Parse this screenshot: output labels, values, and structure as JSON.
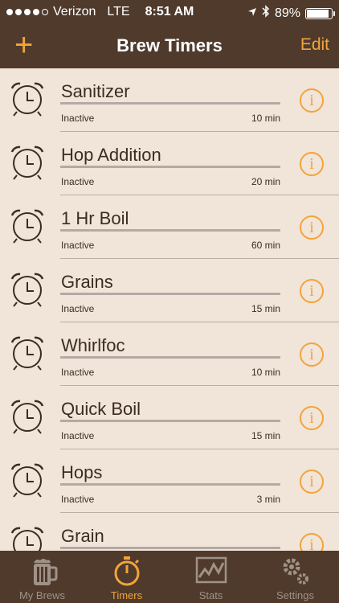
{
  "status_bar": {
    "carrier": "Verizon",
    "network": "LTE",
    "time": "8:51 AM",
    "battery": "89%",
    "battery_level": 0.89
  },
  "nav": {
    "add_label": "+",
    "title": "Brew Timers",
    "edit_label": "Edit"
  },
  "timers": [
    {
      "name": "Sanitizer",
      "status": "Inactive",
      "duration": "10 min"
    },
    {
      "name": "Hop Addition",
      "status": "Inactive",
      "duration": "20 min"
    },
    {
      "name": "1 Hr Boil",
      "status": "Inactive",
      "duration": "60 min"
    },
    {
      "name": "Grains",
      "status": "Inactive",
      "duration": "15 min"
    },
    {
      "name": "Whirlfoc",
      "status": "Inactive",
      "duration": "10 min"
    },
    {
      "name": "Quick Boil",
      "status": "Inactive",
      "duration": "15 min"
    },
    {
      "name": "Hops",
      "status": "Inactive",
      "duration": "3 min"
    },
    {
      "name": "Grain",
      "status": "",
      "duration": ""
    }
  ],
  "info_symbol": "i",
  "tabs": [
    {
      "label": "My Brews",
      "icon": "beer-mug-icon",
      "active": false
    },
    {
      "label": "Timers",
      "icon": "stopwatch-icon",
      "active": true
    },
    {
      "label": "Stats",
      "icon": "chart-icon",
      "active": false
    },
    {
      "label": "Settings",
      "icon": "gears-icon",
      "active": false
    }
  ],
  "colors": {
    "bar_background": "#4f3a2c",
    "accent": "#f2a43a",
    "list_background": "#f1e4d9",
    "inactive_tab": "#a09287"
  }
}
